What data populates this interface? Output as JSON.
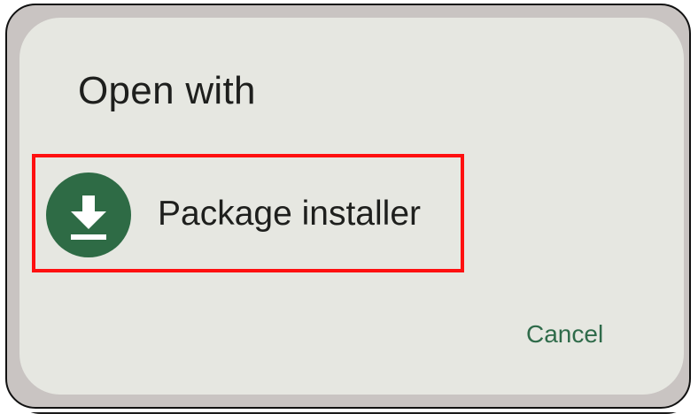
{
  "dialog": {
    "title": "Open with",
    "options": [
      {
        "label": "Package installer",
        "icon": "download-icon"
      }
    ],
    "cancel_label": "Cancel"
  },
  "colors": {
    "dialog_background": "#e6e7e1",
    "icon_background": "#2e6b45",
    "highlight_border": "#ff1010",
    "accent": "#2f6b4a",
    "text": "#1e1f1d"
  }
}
